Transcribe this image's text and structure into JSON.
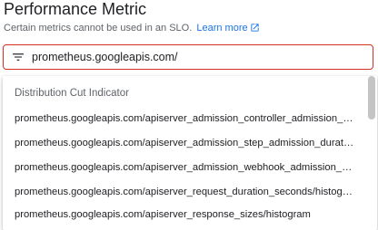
{
  "section": {
    "title": "Performance Metric",
    "helper_text": "Certain metrics cannot be used in an SLO.",
    "learn_more_label": "Learn more"
  },
  "icons": {
    "filter": "filter-icon",
    "external_link": "open-in-new-icon"
  },
  "colors": {
    "error_border": "#d93025",
    "link": "#1a73e8",
    "secondary_text": "#5f6368"
  },
  "search": {
    "value": "prometheus.googleapis.com/"
  },
  "dropdown": {
    "group_header": "Distribution Cut Indicator",
    "options": [
      "prometheus.googleapis.com/apiserver_admission_controller_admission_duratio",
      "prometheus.googleapis.com/apiserver_admission_step_admission_duration_s",
      "prometheus.googleapis.com/apiserver_admission_webhook_admission_durati",
      "prometheus.googleapis.com/apiserver_request_duration_seconds/histogram",
      "prometheus.googleapis.com/apiserver_response_sizes/histogram"
    ]
  }
}
